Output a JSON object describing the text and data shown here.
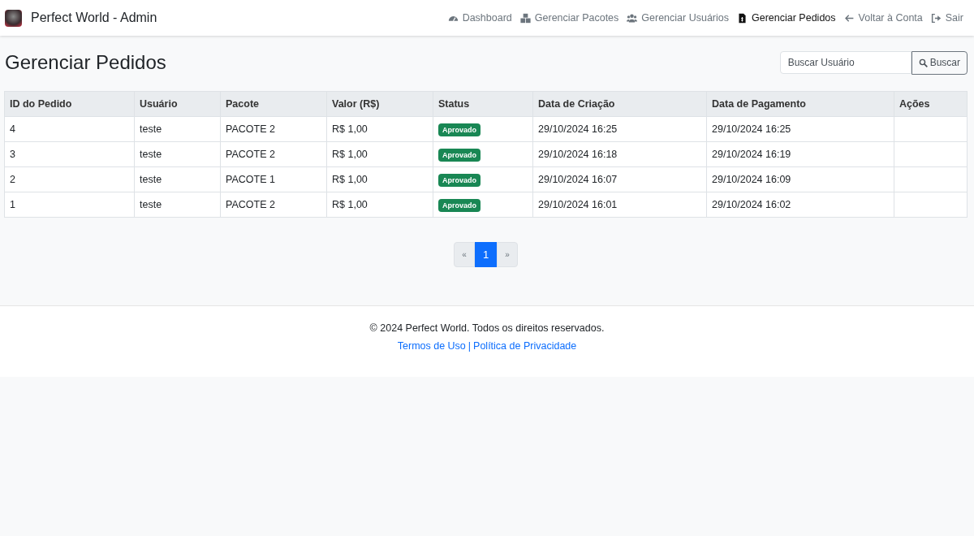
{
  "navbar": {
    "brand": "Perfect World - Admin",
    "items": [
      {
        "label": "Dashboard",
        "kind": "gauge",
        "selected": false
      },
      {
        "label": "Gerenciar Pacotes",
        "kind": "boxes",
        "selected": false
      },
      {
        "label": "Gerenciar Usuários",
        "kind": "users",
        "selected": false
      },
      {
        "label": "Gerenciar Pedidos",
        "kind": "document",
        "selected": true
      },
      {
        "label": "Voltar à Conta",
        "kind": "back",
        "selected": false
      },
      {
        "label": "Sair",
        "kind": "exit",
        "selected": false
      }
    ]
  },
  "page_title": "Gerenciar Pedidos",
  "search": {
    "placeholder": "Buscar Usuário",
    "button": "Buscar"
  },
  "table": {
    "columns": [
      "ID do Pedido",
      "Usuário",
      "Pacote",
      "Valor (R$)",
      "Status",
      "Data de Criação",
      "Data de Pagamento",
      "Ações"
    ],
    "rows": [
      [
        "4",
        "teste",
        "PACOTE 2",
        "R$ 1,00",
        "Aprovado",
        "29/10/2024 16:25",
        "29/10/2024 16:25"
      ],
      [
        "3",
        "teste",
        "PACOTE 2",
        "R$ 1,00",
        "Aprovado",
        "29/10/2024 16:18",
        "29/10/2024 16:19"
      ],
      [
        "2",
        "teste",
        "PACOTE 1",
        "R$ 1,00",
        "Aprovado",
        "29/10/2024 16:07",
        "29/10/2024 16:09"
      ],
      [
        "1",
        "teste",
        "PACOTE 2",
        "R$ 1,00",
        "Aprovado",
        "29/10/2024 16:01",
        "29/10/2024 16:02"
      ]
    ]
  },
  "pagination": [
    {
      "label": "«",
      "selected": false
    },
    {
      "label": "1",
      "selected": true
    },
    {
      "label": "»",
      "selected": false
    }
  ],
  "footer": {
    "copyright": "© 2024 Perfect World. Todos os direitos reservados.",
    "links": [
      "Termos de Uso",
      "Política de Privacidade"
    ],
    "separator": "|"
  }
}
